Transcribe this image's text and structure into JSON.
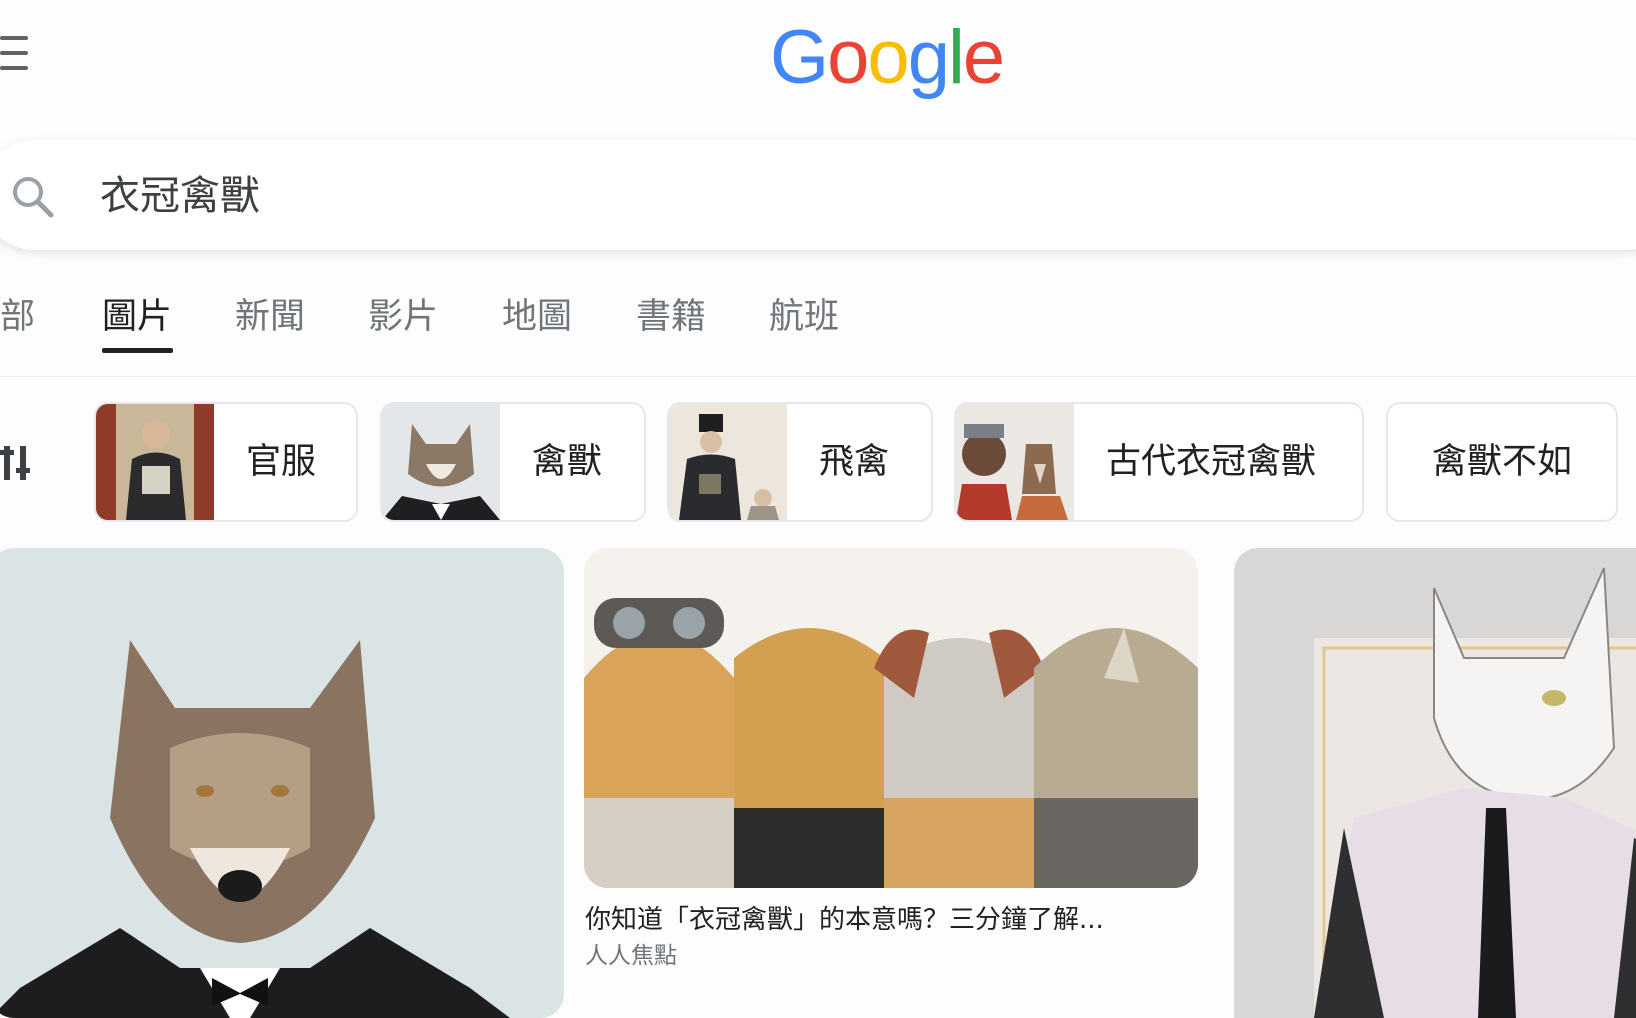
{
  "header": {
    "logo_letters": [
      {
        "char": "G",
        "color": "#4285F4"
      },
      {
        "char": "o",
        "color": "#EA4335"
      },
      {
        "char": "o",
        "color": "#FBBC05"
      },
      {
        "char": "g",
        "color": "#4285F4"
      },
      {
        "char": "l",
        "color": "#34A853"
      },
      {
        "char": "e",
        "color": "#EA4335"
      }
    ],
    "menu_icon": "hamburger-menu-icon"
  },
  "search": {
    "query": "衣冠禽獸",
    "icon": "search-icon"
  },
  "tabs": [
    {
      "label": "全部",
      "active": false
    },
    {
      "label": "圖片",
      "active": true
    },
    {
      "label": "新聞",
      "active": false
    },
    {
      "label": "影片",
      "active": false
    },
    {
      "label": "地圖",
      "active": false
    },
    {
      "label": "書籍",
      "active": false
    },
    {
      "label": "航班",
      "active": false
    }
  ],
  "chips": [
    {
      "label": "官服",
      "thumb": "official-robe-portrait"
    },
    {
      "label": "禽獸",
      "thumb": "wolf-in-suit"
    },
    {
      "label": "飛禽",
      "thumb": "ming-official-painting"
    },
    {
      "label": "古代衣冠禽獸",
      "thumb": "animals-in-clothes"
    },
    {
      "label": "禽獸不如",
      "thumb": ""
    }
  ],
  "results": [
    {
      "image": "wolf-in-tuxedo",
      "title": "",
      "source": ""
    },
    {
      "image": "four-animals-in-coats",
      "title": "你知道「衣冠禽獸」的本意嗎？三分鐘了解...",
      "source": "人人焦點"
    },
    {
      "image": "white-cat-in-suit",
      "title": "",
      "source": ""
    }
  ],
  "colors": {
    "accent_underline": "#202124",
    "tab_inactive": "#70757a",
    "chip_border": "#e6e7ea"
  }
}
